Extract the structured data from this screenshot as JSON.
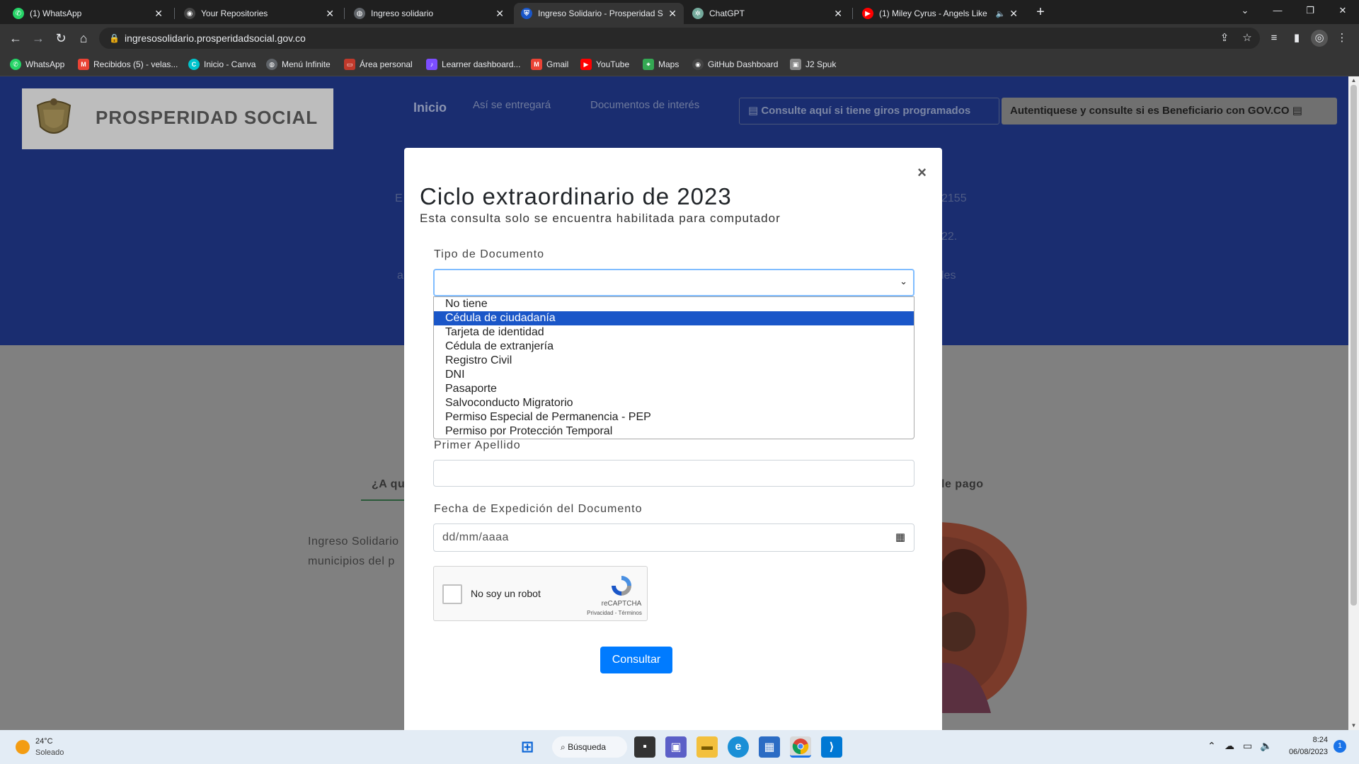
{
  "browser": {
    "tabs": [
      {
        "title": "(1) WhatsApp",
        "icon": "whatsapp-icon",
        "color": "#25d366"
      },
      {
        "title": "Your Repositories",
        "icon": "github-icon",
        "color": "#444444"
      },
      {
        "title": "Ingreso solidario",
        "icon": "globe-icon",
        "color": "#5f6368"
      },
      {
        "title": "Ingreso Solidario - Prosperidad S",
        "icon": "shield-icon",
        "color": "#1a56c8"
      },
      {
        "title": "ChatGPT",
        "icon": "chatgpt-icon",
        "color": "#74aa9c"
      },
      {
        "title": "(1) Miley Cyrus - Angels Like",
        "icon": "youtube-icon",
        "color": "#ff0000"
      }
    ],
    "url": "ingresosolidario.prosperidadsocial.gov.co",
    "bookmarks": [
      {
        "label": "WhatsApp",
        "icon": "whatsapp-icon",
        "color": "#25d366"
      },
      {
        "label": "Recibidos (5) - velas...",
        "icon": "gmail-icon",
        "color": "#ea4335"
      },
      {
        "label": "Inicio - Canva",
        "icon": "canva-icon",
        "color": "#00c4cc"
      },
      {
        "label": "Menú Infinite",
        "icon": "globe-icon",
        "color": "#5f6368"
      },
      {
        "label": "Área personal",
        "icon": "moodle-icon",
        "color": "#c0392b"
      },
      {
        "label": "Learner dashboard...",
        "icon": "learner-icon",
        "color": "#7c4dff"
      },
      {
        "label": "Gmail",
        "icon": "gmail-icon",
        "color": "#ea4335"
      },
      {
        "label": "YouTube",
        "icon": "youtube-icon",
        "color": "#ff0000"
      },
      {
        "label": "Maps",
        "icon": "maps-icon",
        "color": "#34a853"
      },
      {
        "label": "GitHub Dashboard",
        "icon": "github-icon",
        "color": "#444444"
      },
      {
        "label": "J2 Spuk",
        "icon": "profile-icon",
        "color": "#888888"
      }
    ]
  },
  "site": {
    "logo_text": "PROSPERIDAD SOCIAL",
    "nav": {
      "home": "Inicio",
      "delivery": "Así se entregará",
      "documents": "Documentos de interés"
    },
    "giros_button": "Consulte aquí si tiene giros programados",
    "gov_button": "Autentiquese y consulte si es Beneficiario con GOV.CO",
    "fragments": {
      "hero_e": "E",
      "hero_a": "a",
      "hero_155": "2155",
      "hero_22": "22.",
      "hero_les": "les",
      "tab_aq": "¿A qu",
      "tab_pago": "le pago",
      "body_1": "Ingreso Solidario",
      "body_2": "municipios del p"
    }
  },
  "modal": {
    "close": "×",
    "title": "Ciclo extraordinario de 2023",
    "subtitle": "Esta consulta solo se encuentra habilitada para computador",
    "doc_type_label": "Tipo de Documento",
    "doc_type_value": "",
    "doc_type_options": [
      "No tiene",
      "Cédula de ciudadanía",
      "Tarjeta de identidad",
      "Cédula de extranjería",
      "Registro Civil",
      "DNI",
      "Pasaporte",
      "Salvoconducto Migratorio",
      "Permiso Especial de Permanencia - PEP",
      "Permiso por Protección Temporal"
    ],
    "highlighted_option": "Cédula de ciudadanía",
    "last_name_label": "Primer Apellido",
    "last_name_value": "",
    "date_label": "Fecha de Expedición del Documento",
    "date_placeholder": "dd/mm/aaaa",
    "captcha_label": "No soy un robot",
    "captcha_brand": "reCAPTCHA",
    "captcha_terms": "Privacidad - Términos",
    "submit": "Consultar"
  },
  "taskbar": {
    "temperature": "24°C",
    "condition": "Soleado",
    "search": "Búsqueda",
    "time": "8:24",
    "date": "06/08/2023",
    "notifications": "1"
  }
}
